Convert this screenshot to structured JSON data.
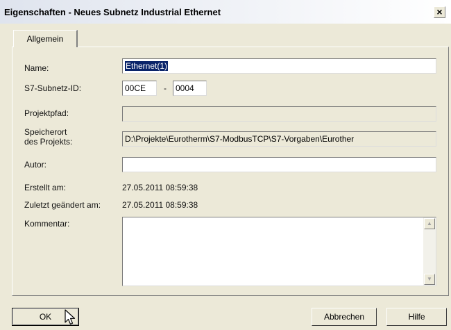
{
  "window": {
    "title": "Eigenschaften - Neues Subnetz Industrial Ethernet",
    "close_glyph": "×"
  },
  "tabs": [
    {
      "label": "Allgemein"
    }
  ],
  "fields": {
    "name": {
      "label": "Name:",
      "value": "Ethernet(1)"
    },
    "subnet_id": {
      "label": "S7-Subnetz-ID:",
      "part1": "00CE",
      "separator": "-",
      "part2": "0004"
    },
    "project_path": {
      "label": "Projektpfad:",
      "value": ""
    },
    "storage": {
      "label_line1": "Speicherort",
      "label_line2": "des Projekts:",
      "value": "D:\\Projekte\\Eurotherm\\S7-ModbusTCP\\S7-Vorgaben\\Eurother"
    },
    "author": {
      "label": "Autor:",
      "value": ""
    },
    "created": {
      "label": "Erstellt am:",
      "value": "27.05.2011 08:59:38"
    },
    "modified": {
      "label": "Zuletzt geändert am:",
      "value": "27.05.2011 08:59:38"
    },
    "comment": {
      "label": "Kommentar:",
      "value": ""
    }
  },
  "buttons": {
    "ok": "OK",
    "cancel": "Abbrechen",
    "help": "Hilfe"
  },
  "icons": {
    "scroll_up": "▲",
    "scroll_down": "▼"
  }
}
